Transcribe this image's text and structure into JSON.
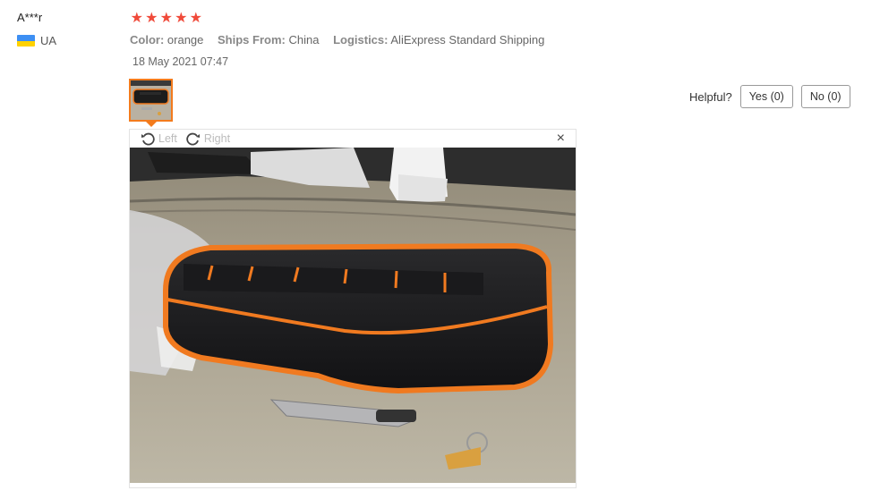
{
  "reviewer": {
    "name": "A***r",
    "country": "UA"
  },
  "rating": {
    "stars": 5,
    "glyphs": [
      "★",
      "★",
      "★",
      "★",
      "★"
    ]
  },
  "attributes": [
    {
      "key": "Color:",
      "value": "orange"
    },
    {
      "key": "Ships From:",
      "value": "China"
    },
    {
      "key": "Logistics:",
      "value": "AliExpress Standard Shipping"
    }
  ],
  "date": "18 May 2021 07:47",
  "helpful": {
    "label": "Helpful?",
    "yes": "Yes (0)",
    "no": "No (0)"
  },
  "viewer": {
    "rotate_left": "Left",
    "rotate_right": "Right",
    "close": "×"
  },
  "colors": {
    "star": "#f04a3a",
    "accent": "#f37b1d",
    "flag_blue": "#3d8ff3",
    "flag_yellow": "#ffd200"
  }
}
